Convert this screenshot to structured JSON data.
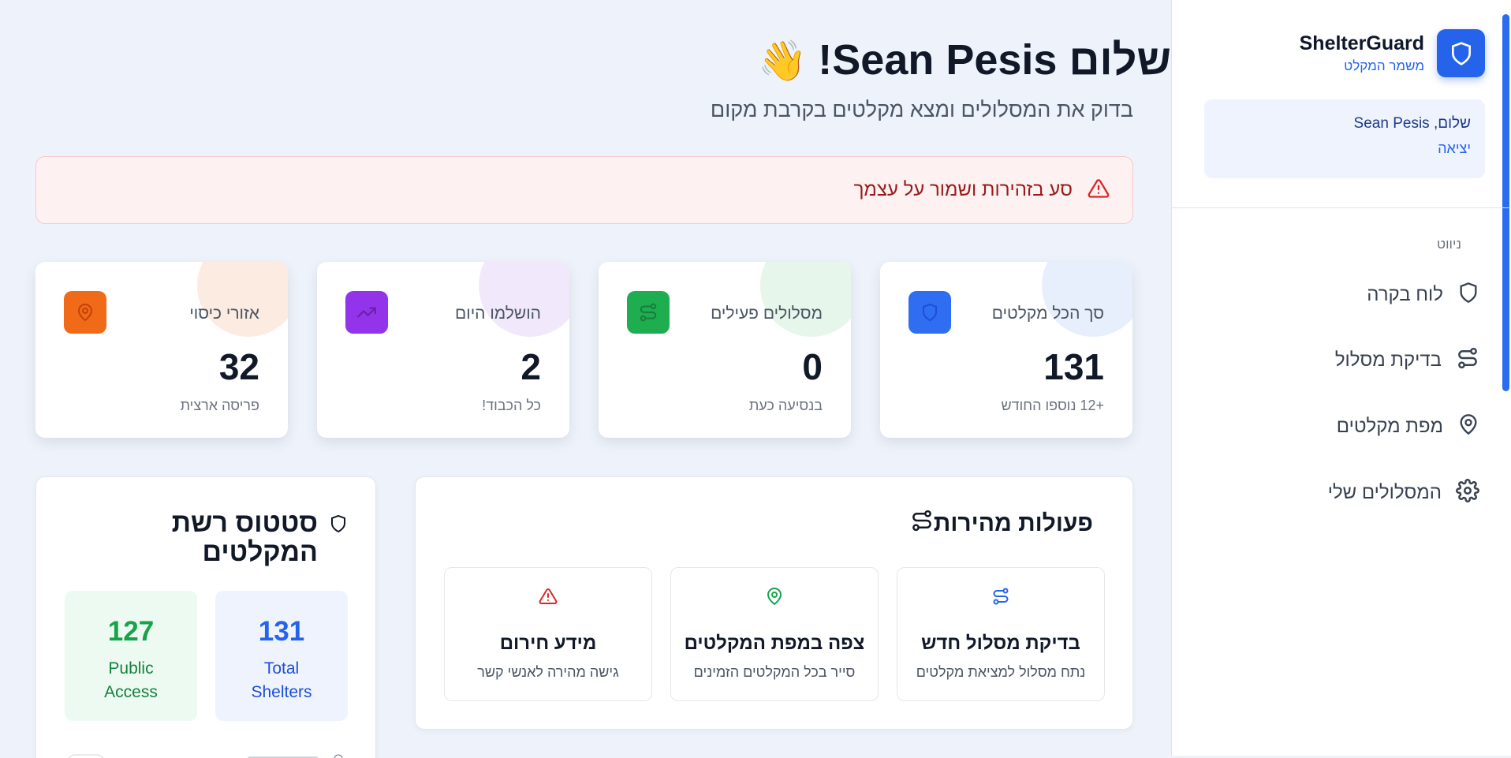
{
  "sidebar": {
    "brand_name": "ShelterGuard",
    "brand_sub": "משמר המקלט",
    "user_greeting": "שלום, Sean Pesis",
    "logout": "יציאה",
    "nav_label": "ניווט",
    "nav_items": [
      {
        "label": "לוח בקרה",
        "icon": "shield-icon"
      },
      {
        "label": "בדיקת מסלול",
        "icon": "route-icon"
      },
      {
        "label": "מפת מקלטים",
        "icon": "map-pin-icon"
      },
      {
        "label": "המסלולים שלי",
        "icon": "gear-icon"
      }
    ]
  },
  "header": {
    "greeting": "שלום Sean Pesis!",
    "wave": "👋",
    "subtitle": "בדוק את המסלולים ומצא מקלטים בקרבת מקום"
  },
  "alert": {
    "text": "סע בזהירות ושמור על עצמך",
    "icon": "warning-icon"
  },
  "stats": [
    {
      "title": "סך הכל מקלטים",
      "value": "131",
      "note": "+12 נוספו החודש",
      "icon": "shield-icon",
      "color": "#2f6ef0",
      "blob": "#e6edfc"
    },
    {
      "title": "מסלולים פעילים",
      "value": "0",
      "note": "בנסיעה כעת",
      "icon": "route-icon",
      "color": "#1fae4f",
      "blob": "#e3f5e8"
    },
    {
      "title": "הושלמו היום",
      "value": "2",
      "note": "כל הכבוד!",
      "icon": "trending-up-icon",
      "color": "#9333ea",
      "blob": "#efe6fb"
    },
    {
      "title": "אזורי כיסוי",
      "value": "32",
      "note": "פריסה ארצית",
      "icon": "map-pin-icon",
      "color": "#f16a17",
      "blob": "#fbe9de"
    }
  ],
  "quick_actions": {
    "title": "פעולות מהירות",
    "items": [
      {
        "title": "בדיקת מסלול חדש",
        "desc": "נתח מסלול למציאת מקלטים",
        "icon": "route-icon",
        "color": "#2563eb"
      },
      {
        "title": "צפה במפת המקלטים",
        "desc": "סייר בכל המקלטים הזמינים",
        "icon": "map-pin-icon",
        "color": "#16a34a"
      },
      {
        "title": "מידע חירום",
        "desc": "גישה מהירה לאנשי קשר",
        "icon": "warning-icon",
        "color": "#dc2626"
      }
    ]
  },
  "network_status": {
    "title": "סטטוס רשת המקלטים",
    "boxes": [
      {
        "value": "131",
        "label": "Total Shelters",
        "color": "#2563eb",
        "bg": "#eef3fd"
      },
      {
        "value": "127",
        "label": "Public Access",
        "color": "#16a34a",
        "bg": "#edfaf1"
      }
    ]
  }
}
